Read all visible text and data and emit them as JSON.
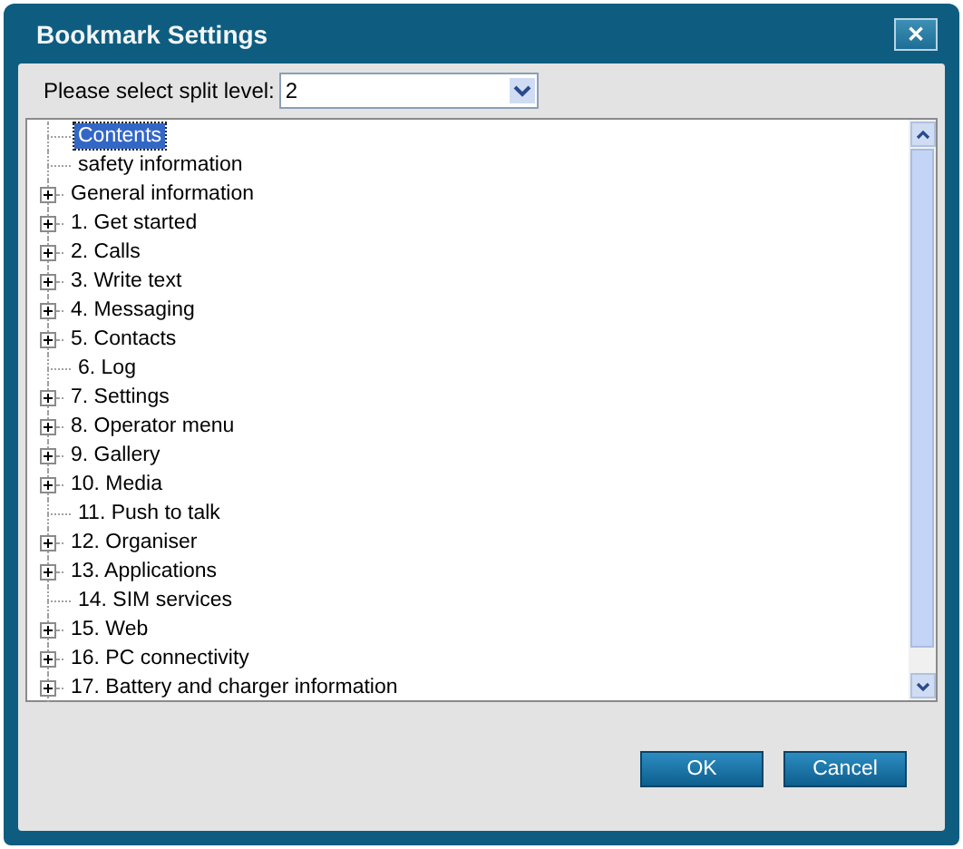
{
  "window": {
    "title": "Bookmark Settings",
    "close": "✕"
  },
  "split_level": {
    "label": "Please select split level:",
    "value": "2"
  },
  "tree": {
    "items": [
      {
        "label": "Contents",
        "kind": "leaf",
        "selected": true
      },
      {
        "label": "safety information",
        "kind": "leaf",
        "selected": false
      },
      {
        "label": "General information",
        "kind": "folder",
        "selected": false
      },
      {
        "label": "1. Get started",
        "kind": "folder",
        "selected": false
      },
      {
        "label": "2. Calls",
        "kind": "folder",
        "selected": false
      },
      {
        "label": "3. Write text",
        "kind": "folder",
        "selected": false
      },
      {
        "label": "4. Messaging",
        "kind": "folder",
        "selected": false
      },
      {
        "label": "5. Contacts",
        "kind": "folder",
        "selected": false
      },
      {
        "label": "6. Log",
        "kind": "leaf",
        "selected": false
      },
      {
        "label": "7. Settings",
        "kind": "folder",
        "selected": false
      },
      {
        "label": "8. Operator menu",
        "kind": "folder",
        "selected": false
      },
      {
        "label": "9. Gallery",
        "kind": "folder",
        "selected": false
      },
      {
        "label": "10. Media",
        "kind": "folder",
        "selected": false
      },
      {
        "label": "11. Push to talk",
        "kind": "leaf",
        "selected": false
      },
      {
        "label": "12. Organiser",
        "kind": "folder",
        "selected": false
      },
      {
        "label": "13. Applications",
        "kind": "folder",
        "selected": false
      },
      {
        "label": "14. SIM services",
        "kind": "leaf",
        "selected": false
      },
      {
        "label": "15. Web",
        "kind": "folder",
        "selected": false
      },
      {
        "label": "16. PC connectivity",
        "kind": "folder",
        "selected": false
      },
      {
        "label": "17. Battery and charger information",
        "kind": "folder",
        "selected": false
      }
    ]
  },
  "buttons": [
    "OK",
    "Cancel"
  ]
}
